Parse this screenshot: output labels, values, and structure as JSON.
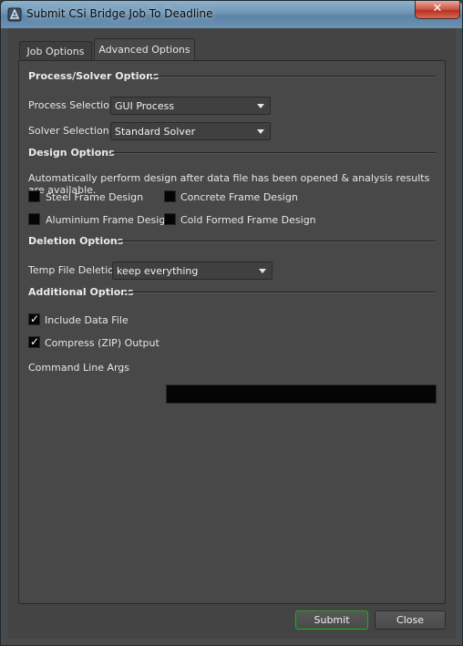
{
  "window": {
    "title": "Submit CSi Bridge Job To Deadline",
    "close_glyph": "✕",
    "icon": "app-icon"
  },
  "tabs": [
    {
      "label": "Job Options",
      "active": false
    },
    {
      "label": "Advanced Options",
      "active": true
    }
  ],
  "process_solver": {
    "title": "Process/Solver Options",
    "process_label": "Process Selection",
    "process_value": "GUI Process",
    "solver_label": "Solver Selection",
    "solver_value": "Standard Solver"
  },
  "design": {
    "title": "Design Options",
    "description": "Automatically perform design after data file has been opened & analysis results are available.",
    "options": [
      {
        "label": "Steel Frame Design",
        "checked": false
      },
      {
        "label": "Concrete Frame Design",
        "checked": false
      },
      {
        "label": "Aluminium Frame Design",
        "checked": false
      },
      {
        "label": "Cold Formed Frame Design",
        "checked": false
      }
    ]
  },
  "deletion": {
    "title": "Deletion Options",
    "temp_label": "Temp File Deletion",
    "temp_value": "keep everything"
  },
  "additional": {
    "title": "Additional Options",
    "include_data_file": {
      "label": "Include Data File",
      "checked": true
    },
    "compress_output": {
      "label": "Compress (ZIP) Output",
      "checked": true
    },
    "cmd_label": "Command Line Args",
    "cmd_value": ""
  },
  "footer": {
    "submit_label": "Submit",
    "close_label": "Close"
  },
  "colors": {
    "accent_default_button": "#3a9b3a",
    "titlebar": "#6e93b1"
  }
}
